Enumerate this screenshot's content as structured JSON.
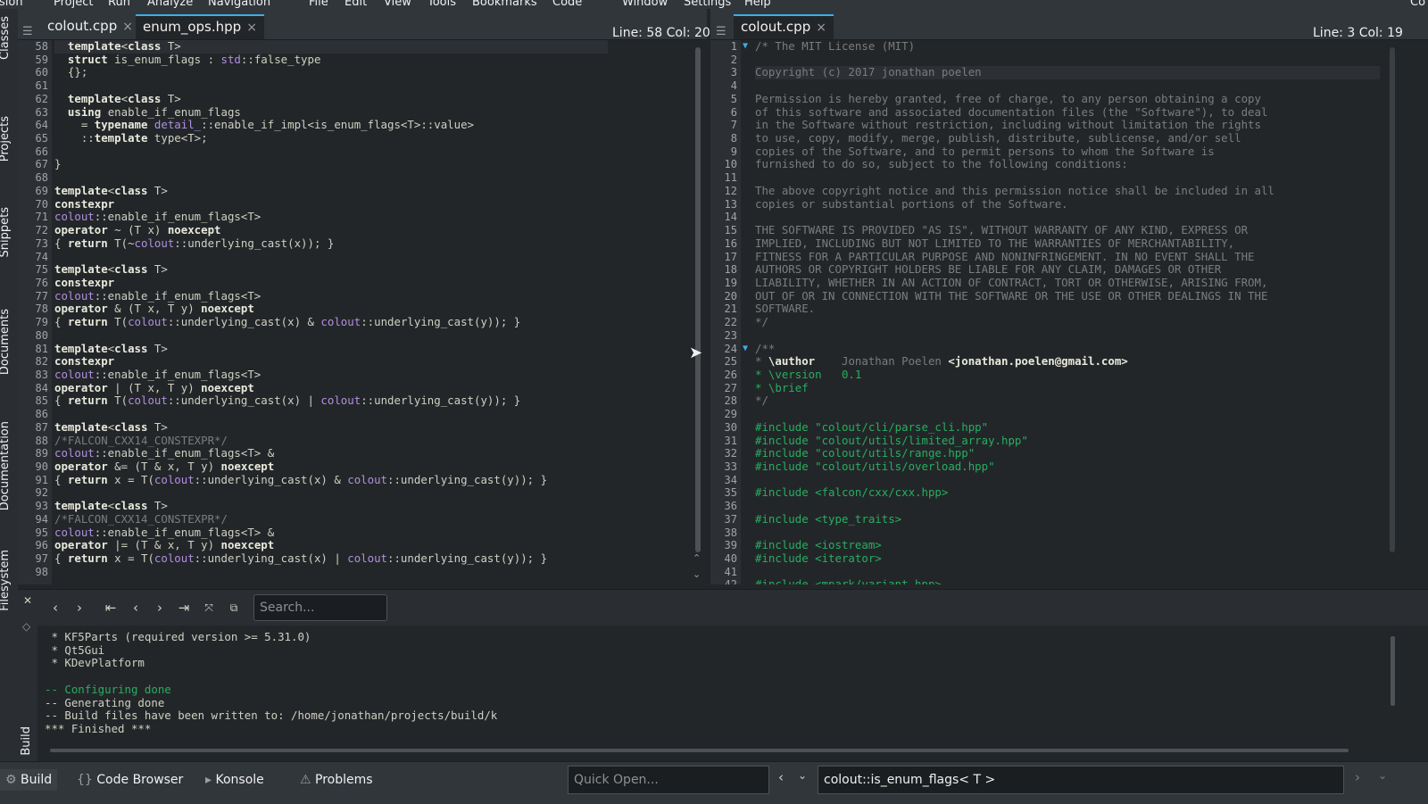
{
  "menubar": [
    "Session",
    "Project",
    "Run",
    "Analyze",
    "Navigation",
    "File",
    "Edit",
    "View",
    "Tools",
    "Bookmarks",
    "Code",
    "Window",
    "Settings",
    "Help"
  ],
  "menubar_right": "Co",
  "side_tabs": [
    "Classes",
    "Projects",
    "Snippets",
    "Documents",
    "Documentation",
    "Filesystem"
  ],
  "left_editor": {
    "tabs": [
      {
        "label": "colout.cpp",
        "close": "×"
      },
      {
        "label": "enum_ops.hpp",
        "close": "×"
      }
    ],
    "status": "Line: 58 Col: 20",
    "line_start": 58,
    "lines": [
      "  template<class T>",
      "  struct is_enum_flags : std::false_type",
      "  {};",
      "",
      "  template<class T>",
      "  using enable_if_enum_flags",
      "    = typename detail_::enable_if_impl<is_enum_flags<T>::value>",
      "    ::template type<T>;",
      "",
      "}",
      "",
      "template<class T>",
      "constexpr",
      "colout::enable_if_enum_flags<T>",
      "operator ~ (T x) noexcept",
      "{ return T(~colout::underlying_cast(x)); }",
      "",
      "template<class T>",
      "constexpr",
      "colout::enable_if_enum_flags<T>",
      "operator & (T x, T y) noexcept",
      "{ return T(colout::underlying_cast(x) & colout::underlying_cast(y)); }",
      "",
      "template<class T>",
      "constexpr",
      "colout::enable_if_enum_flags<T>",
      "operator | (T x, T y) noexcept",
      "{ return T(colout::underlying_cast(x) | colout::underlying_cast(y)); }",
      "",
      "template<class T>",
      "/*FALCON_CXX14_CONSTEXPR*/",
      "colout::enable_if_enum_flags<T> &",
      "operator &= (T & x, T y) noexcept",
      "{ return x = T(colout::underlying_cast(x) & colout::underlying_cast(y)); }",
      "",
      "template<class T>",
      "/*FALCON_CXX14_CONSTEXPR*/",
      "colout::enable_if_enum_flags<T> &",
      "operator |= (T & x, T y) noexcept",
      "{ return x = T(colout::underlying_cast(x) | colout::underlying_cast(y)); }",
      ""
    ]
  },
  "right_editor": {
    "tabs": [
      {
        "label": "colout.cpp",
        "close": "×"
      }
    ],
    "status": "Line: 3 Col: 19",
    "line_start": 1,
    "lines": [
      "/* The MIT License (MIT)",
      "",
      "Copyright (c) 2017 jonathan poelen",
      "",
      "Permission is hereby granted, free of charge, to any person obtaining a copy",
      "of this software and associated documentation files (the \"Software\"), to deal",
      "in the Software without restriction, including without limitation the rights",
      "to use, copy, modify, merge, publish, distribute, sublicense, and/or sell",
      "copies of the Software, and to permit persons to whom the Software is",
      "furnished to do so, subject to the following conditions:",
      "",
      "The above copyright notice and this permission notice shall be included in all",
      "copies or substantial portions of the Software.",
      "",
      "THE SOFTWARE IS PROVIDED \"AS IS\", WITHOUT WARRANTY OF ANY KIND, EXPRESS OR",
      "IMPLIED, INCLUDING BUT NOT LIMITED TO THE WARRANTIES OF MERCHANTABILITY,",
      "FITNESS FOR A PARTICULAR PURPOSE AND NONINFRINGEMENT. IN NO EVENT SHALL THE",
      "AUTHORS OR COPYRIGHT HOLDERS BE LIABLE FOR ANY CLAIM, DAMAGES OR OTHER",
      "LIABILITY, WHETHER IN AN ACTION OF CONTRACT, TORT OR OTHERWISE, ARISING FROM,",
      "OUT OF OR IN CONNECTION WITH THE SOFTWARE OR THE USE OR OTHER DEALINGS IN THE",
      "SOFTWARE.",
      "*/",
      "",
      "/**",
      "* \\author    Jonathan Poelen <jonathan.poelen@gmail.com>",
      "* \\version   0.1",
      "* \\brief",
      "*/",
      "",
      "#include \"colout/cli/parse_cli.hpp\"",
      "#include \"colout/utils/limited_array.hpp\"",
      "#include \"colout/utils/range.hpp\"",
      "#include \"colout/utils/overload.hpp\"",
      "",
      "#include <falcon/cxx/cxx.hpp>",
      "",
      "#include <type_traits>",
      "",
      "#include <iostream>",
      "#include <iterator>",
      "",
      "#include <mpark/variant.hpp>"
    ]
  },
  "build": {
    "label": "Build",
    "search_placeholder": "Search...",
    "output": [
      {
        "text": " * KF5Parts (required version >= 5.31.0)",
        "color": "normal"
      },
      {
        "text": " * Qt5Gui",
        "color": "normal"
      },
      {
        "text": " * KDevPlatform",
        "color": "normal"
      },
      {
        "text": "",
        "color": "normal"
      },
      {
        "text": "-- Configuring done",
        "color": "green"
      },
      {
        "text": "-- Generating done",
        "color": "normal"
      },
      {
        "text": "-- Build files have been written to: /home/jonathan/projects/build/k",
        "color": "normal"
      },
      {
        "text": "*** Finished ***",
        "color": "normal"
      }
    ]
  },
  "bottom_tabs": [
    "Build",
    "Code Browser",
    "Konsole",
    "Problems"
  ],
  "quick_open_placeholder": "Quick Open...",
  "context": "colout::is_enum_flags< T >"
}
